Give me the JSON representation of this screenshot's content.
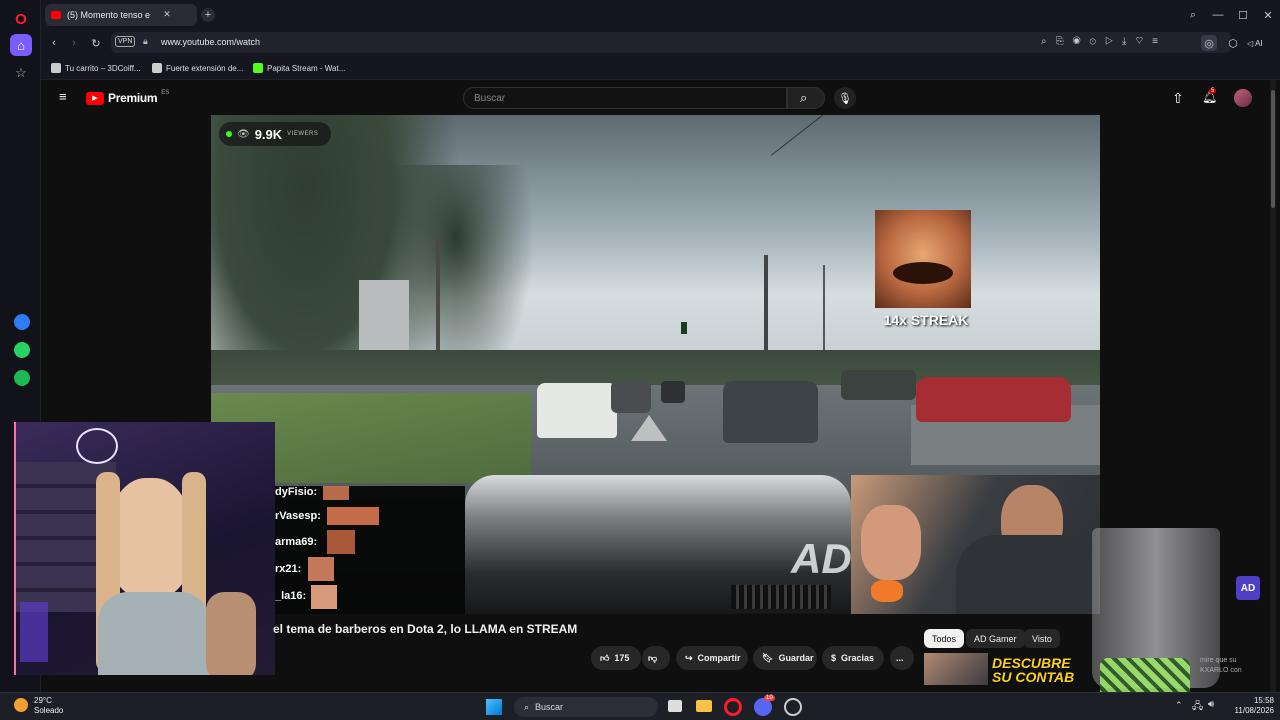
{
  "browser": {
    "tab_title": "(5) Momento tenso e",
    "url": "www.youtube.com/watch",
    "vpn_label": "VPN",
    "ai_label": "AI",
    "bookmarks": [
      "Tu carrito – 3DCoiff...",
      "Fuerte extensión de...",
      "Papita Stream - Wat..."
    ]
  },
  "youtube": {
    "logo_text": "Premium",
    "region": "ES",
    "search_placeholder": "Buscar",
    "notifications_count": "5"
  },
  "stream_overlay": {
    "viewers": "9.9K",
    "viewers_label": "VIEWERS",
    "streak_text": "14x STREAK",
    "chat_users": [
      "dyFisio:",
      "rVasesp:",
      "arma69:",
      "rx21:",
      "_la16:"
    ],
    "watermark": "AD"
  },
  "video": {
    "title": "el tema de barberos en Dota 2, lo LLAMA en STREAM",
    "likes": "175",
    "share_label": "Compartir",
    "save_label": "Guardar",
    "thanks_label": "Gracias",
    "more_label": "..."
  },
  "sidebar_chips": {
    "chips": [
      "Todos",
      "AD Gamer",
      "Visto"
    ],
    "promo_text_1": "DESCUBRE",
    "promo_text_2": "SU CONTAB",
    "promo_small_1": "mire que su",
    "promo_small_2": "KXARLO con"
  },
  "taskbar": {
    "weather_temp": "29°C",
    "weather_desc": "Soleado",
    "search_label": "Buscar",
    "time": "15:58",
    "date": "11/08/2026",
    "discord_badge": "10"
  },
  "colors": {
    "youtube_red": "#ff0000",
    "opera_red": "#ff1b2d",
    "accent_purple": "#7b5cff"
  }
}
